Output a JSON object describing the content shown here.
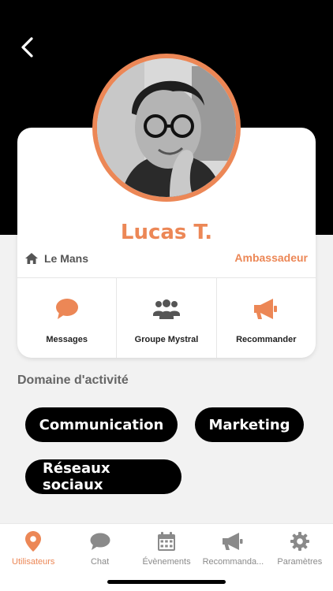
{
  "profile": {
    "name": "Lucas T.",
    "location": "Le Mans",
    "role": "Ambassadeur"
  },
  "actions": [
    {
      "label": "Messages",
      "icon": "chat-bubble-icon"
    },
    {
      "label": "Groupe Mystral",
      "icon": "group-icon"
    },
    {
      "label": "Recommander",
      "icon": "megaphone-icon"
    }
  ],
  "activity": {
    "title": "Domaine d'activité",
    "tags": [
      "Communication",
      "Marketing",
      "Réseaux sociaux"
    ]
  },
  "tabs": [
    {
      "label": "Utilisateurs",
      "icon": "map-pin-icon",
      "active": true
    },
    {
      "label": "Chat",
      "icon": "chat-bubble-icon",
      "active": false
    },
    {
      "label": "Évènements",
      "icon": "calendar-icon",
      "active": false
    },
    {
      "label": "Recommanda...",
      "icon": "megaphone-icon",
      "active": false
    },
    {
      "label": "Paramètres",
      "icon": "gear-icon",
      "active": false
    }
  ],
  "colors": {
    "accent": "#ec8756",
    "header_bg": "#000000",
    "page_bg": "#f2f2f2",
    "tab_inactive": "#8a8a8a",
    "chip_bg": "#000000"
  }
}
